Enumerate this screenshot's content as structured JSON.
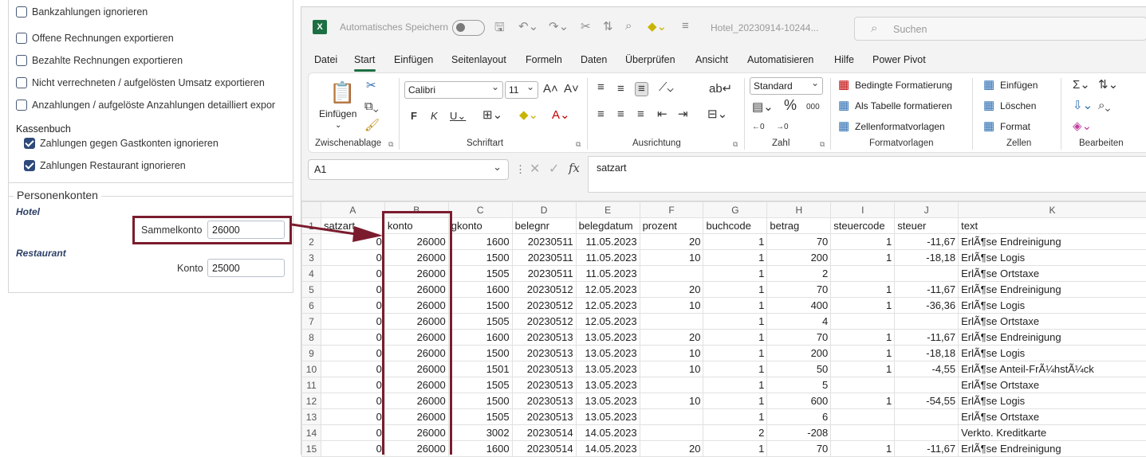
{
  "left_panel": {
    "checkboxes_top": [
      {
        "label": "Bankzahlungen ignorieren",
        "checked": false
      },
      {
        "label": "Offene Rechnungen exportieren",
        "checked": false
      },
      {
        "label": "Bezahlte Rechnungen exportieren",
        "checked": false
      },
      {
        "label": "Nicht verrechneten / aufgelösten Umsatz exportieren",
        "checked": false
      },
      {
        "label": "Anzahlungen / aufgelöste Anzahlungen detailliert expor",
        "checked": false
      }
    ],
    "kassenbuch_title": "Kassenbuch",
    "kassenbuch_items": [
      {
        "label": "Zahlungen gegen Gastkonten ignorieren",
        "checked": true
      },
      {
        "label": "Zahlungen Restaurant ignorieren",
        "checked": true
      }
    ],
    "personenkonten": {
      "legend": "Personenkonten",
      "hotel_label": "Hotel",
      "sammelkonto_label": "Sammelkonto",
      "sammelkonto_value": "26000",
      "restaurant_label": "Restaurant",
      "konto_label": "Konto",
      "konto_value": "25000"
    }
  },
  "excel": {
    "logo": "X",
    "autosave_label": "Automatisches Speichern",
    "filename": "Hotel_20230914-10244...",
    "search_placeholder": "Suchen",
    "menu_tabs": [
      "Datei",
      "Start",
      "Einfügen",
      "Seitenlayout",
      "Formeln",
      "Daten",
      "Überprüfen",
      "Ansicht",
      "Automatisieren",
      "Hilfe",
      "Power Pivot"
    ],
    "active_tab": "Start",
    "ribbon": {
      "paste_label": "Einfügen",
      "font_name": "Calibri",
      "font_size": "11",
      "number_format": "Standard",
      "percent": "%",
      "thousands": "000",
      "cond_format": "Bedingte Formatierung",
      "as_table": "Als Tabelle formatieren",
      "cell_styles": "Zellenformatvorlagen",
      "insert": "Einfügen",
      "delete": "Löschen",
      "format": "Format",
      "groups": [
        "Zwischenablage",
        "Schriftart",
        "Ausrichtung",
        "Zahl",
        "Formatvorlagen",
        "Zellen",
        "Bearbeiten"
      ]
    },
    "name_box": "A1",
    "formula_value": "satzart",
    "columns": [
      "A",
      "B",
      "C",
      "D",
      "E",
      "F",
      "G",
      "H",
      "I",
      "J",
      "K"
    ],
    "header_row": [
      "satzart",
      "konto",
      "gkonto",
      "belegnr",
      "belegdatum",
      "prozent",
      "buchcode",
      "betrag",
      "steuercode",
      "steuer",
      "text"
    ],
    "rows": [
      [
        "0",
        "26000",
        "1600",
        "20230511",
        "11.05.2023",
        "20",
        "1",
        "70",
        "1",
        "-11,67",
        "ErlÃ¶se Endreinigung"
      ],
      [
        "0",
        "26000",
        "1500",
        "20230511",
        "11.05.2023",
        "10",
        "1",
        "200",
        "1",
        "-18,18",
        "ErlÃ¶se Logis"
      ],
      [
        "0",
        "26000",
        "1505",
        "20230511",
        "11.05.2023",
        "",
        "1",
        "2",
        "",
        "",
        "ErlÃ¶se Ortstaxe"
      ],
      [
        "0",
        "26000",
        "1600",
        "20230512",
        "12.05.2023",
        "20",
        "1",
        "70",
        "1",
        "-11,67",
        "ErlÃ¶se Endreinigung"
      ],
      [
        "0",
        "26000",
        "1500",
        "20230512",
        "12.05.2023",
        "10",
        "1",
        "400",
        "1",
        "-36,36",
        "ErlÃ¶se Logis"
      ],
      [
        "0",
        "26000",
        "1505",
        "20230512",
        "12.05.2023",
        "",
        "1",
        "4",
        "",
        "",
        "ErlÃ¶se Ortstaxe"
      ],
      [
        "0",
        "26000",
        "1600",
        "20230513",
        "13.05.2023",
        "20",
        "1",
        "70",
        "1",
        "-11,67",
        "ErlÃ¶se Endreinigung"
      ],
      [
        "0",
        "26000",
        "1500",
        "20230513",
        "13.05.2023",
        "10",
        "1",
        "200",
        "1",
        "-18,18",
        "ErlÃ¶se Logis"
      ],
      [
        "0",
        "26000",
        "1501",
        "20230513",
        "13.05.2023",
        "10",
        "1",
        "50",
        "1",
        "-4,55",
        "ErlÃ¶se Anteil-FrÃ¼hstÃ¼ck"
      ],
      [
        "0",
        "26000",
        "1505",
        "20230513",
        "13.05.2023",
        "",
        "1",
        "5",
        "",
        "",
        "ErlÃ¶se Ortstaxe"
      ],
      [
        "0",
        "26000",
        "1500",
        "20230513",
        "13.05.2023",
        "10",
        "1",
        "600",
        "1",
        "-54,55",
        "ErlÃ¶se Logis"
      ],
      [
        "0",
        "26000",
        "1505",
        "20230513",
        "13.05.2023",
        "",
        "1",
        "6",
        "",
        "",
        "ErlÃ¶se Ortstaxe"
      ],
      [
        "0",
        "26000",
        "3002",
        "20230514",
        "14.05.2023",
        "",
        "2",
        "-208",
        "",
        "",
        "Verkto. Kreditkarte"
      ],
      [
        "0",
        "26000",
        "1600",
        "20230514",
        "14.05.2023",
        "20",
        "1",
        "70",
        "1",
        "-11,67",
        "ErlÃ¶se Endreinigung"
      ]
    ],
    "text_columns": [
      10
    ]
  },
  "colors": {
    "highlight": "#7b1c2e",
    "excel_green": "#1d6f42",
    "checkbox_checked": "#2e4a7a"
  }
}
